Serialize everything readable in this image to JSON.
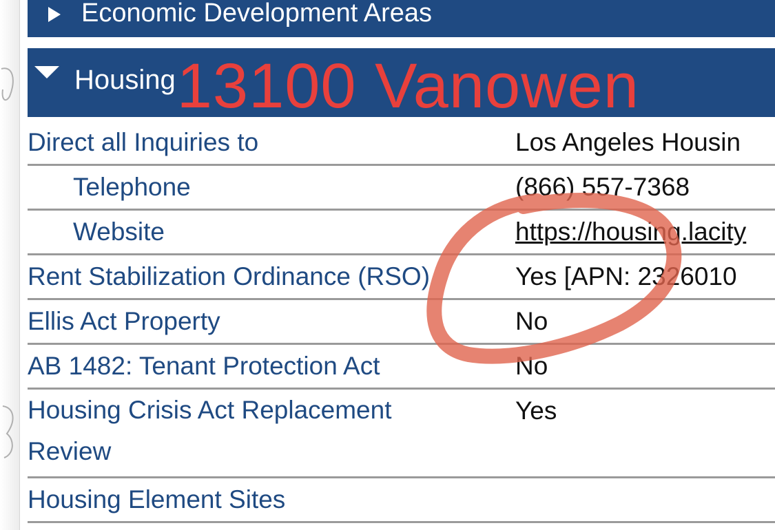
{
  "sections": {
    "economic": {
      "title": "Economic Development Areas"
    },
    "housing": {
      "title": "Housing"
    }
  },
  "overlay": {
    "address_text": "13100 Vanowen",
    "color": "#e8403c"
  },
  "colors": {
    "header_bg": "#1f4a82",
    "label_text": "#1f4a82",
    "annotation": "#e0644e"
  },
  "icons": {
    "collapsed": "caret-right-icon",
    "expanded": "caret-down-icon"
  },
  "rows": [
    {
      "label": "Direct all Inquiries to",
      "value": "Los Angeles Housin"
    },
    {
      "label": "Telephone",
      "value": "(866) 557-7368"
    },
    {
      "label": "Website",
      "value": "https://housing.lacity"
    },
    {
      "label": "Rent Stabilization Ordinance (RSO)",
      "value": "Yes [APN: 2326010"
    },
    {
      "label": "Ellis Act Property",
      "value": "No"
    },
    {
      "label": "AB 1482: Tenant Protection Act",
      "value": "No"
    },
    {
      "label": "Housing Crisis Act Replacement Review",
      "value": "Yes"
    },
    {
      "label": "Housing Element Sites",
      "value": ""
    }
  ]
}
